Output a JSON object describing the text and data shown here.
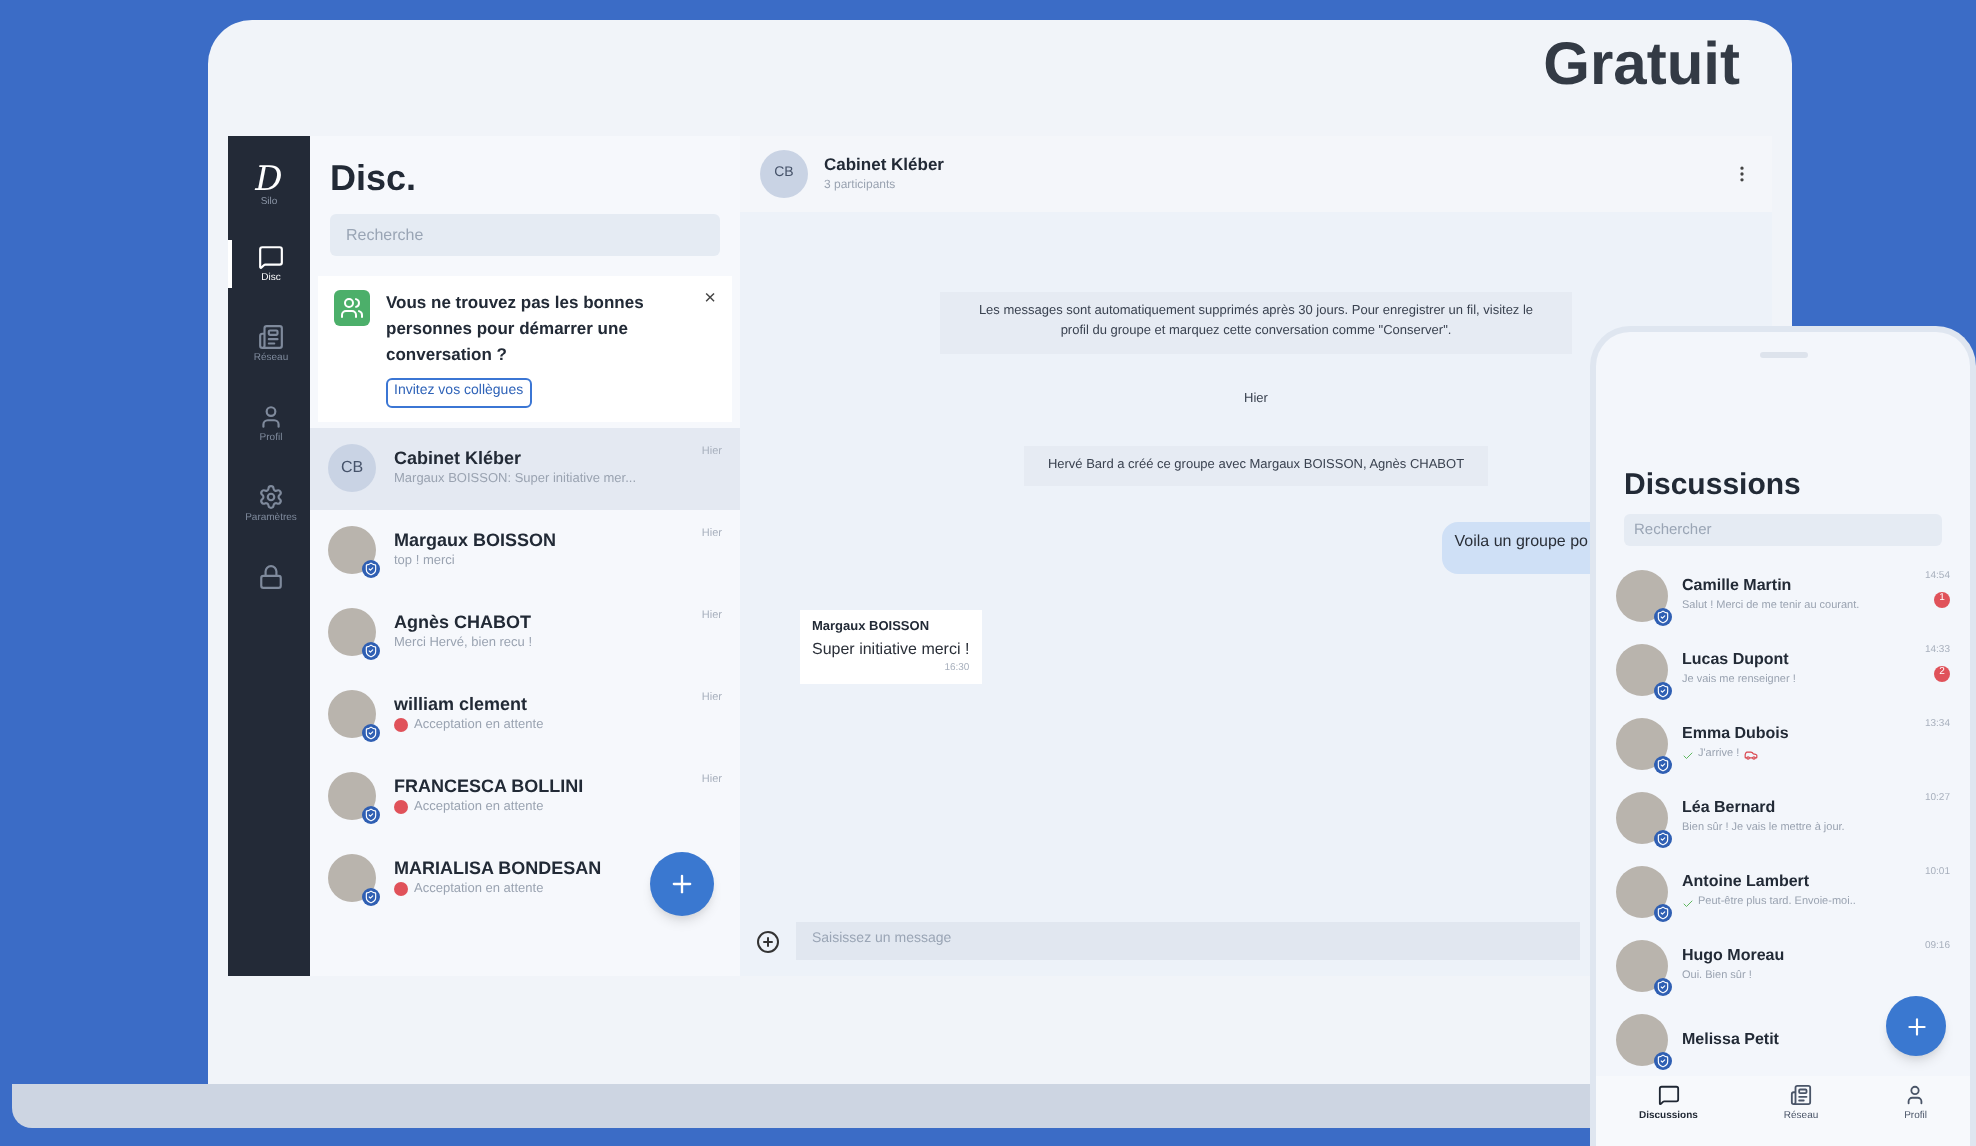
{
  "headline": "Gratuit",
  "laptop": {
    "sidebar": {
      "logo": "D",
      "logo_label": "Silo",
      "items": [
        {
          "label": "Disc",
          "selected": true
        },
        {
          "label": "Réseau",
          "selected": false
        },
        {
          "label": "Profil",
          "selected": false
        },
        {
          "label": "Paramètres",
          "selected": false
        },
        {
          "selected": false
        }
      ]
    },
    "list": {
      "title": "Disc.",
      "search": {
        "placeholder": "Recherche"
      },
      "invite_card": {
        "text": "Vous ne trouvez pas les bonnes personnes pour démarrer une conversation ?",
        "close": "×",
        "button": "Invitez vos collègues"
      },
      "conversations": [
        {
          "kind": "initials",
          "initials": "CB",
          "name": "Cabinet Kléber",
          "preview": "Margaux BOISSON: Super initiative mer...",
          "time": "Hier",
          "selected": true,
          "pending": false
        },
        {
          "kind": "photo",
          "name": "Margaux BOISSON",
          "preview": "top ! merci",
          "time": "Hier",
          "selected": false,
          "pending": false
        },
        {
          "kind": "photo",
          "name": "Agnès CHABOT",
          "preview": "Merci Hervé, bien recu !",
          "time": "Hier",
          "selected": false,
          "pending": false
        },
        {
          "kind": "photo",
          "name": "william clement",
          "preview": "Acceptation en attente",
          "time": "Hier",
          "selected": false,
          "pending": true
        },
        {
          "kind": "photo",
          "name": "FRANCESCA BOLLINI",
          "preview": "Acceptation en attente",
          "time": "Hier",
          "selected": false,
          "pending": true
        },
        {
          "kind": "photo",
          "name": "MARIALISA BONDESAN",
          "preview": "Acceptation en attente",
          "selected": false,
          "pending": true
        }
      ]
    },
    "chat": {
      "header": {
        "initials": "CB",
        "title": "Cabinet Kléber",
        "subtitle": "3 participants"
      },
      "messages": [
        {
          "kind": "system",
          "text": "Les messages sont automatiquement supprimés après 30 jours. Pour enregistrer un fil, visitez le profil du groupe et marquez cette conversation comme \"Conserver\"."
        },
        {
          "kind": "date",
          "text": "Hier"
        },
        {
          "kind": "system",
          "text": "Hervé Bard a créé ce groupe avec Margaux BOISSON, Agnès CHABOT"
        },
        {
          "kind": "outgoing",
          "text": "Voila un groupe po"
        },
        {
          "kind": "incoming",
          "sender": "Margaux BOISSON",
          "text": "Super initiative merci !",
          "time": "16:30"
        }
      ],
      "composer": {
        "placeholder": "Saisissez un message"
      }
    }
  },
  "phone": {
    "title": "Discussions",
    "search": {
      "placeholder": "Rechercher"
    },
    "conversations": [
      {
        "name": "Camille Martin",
        "preview": "Salut ! Merci de me tenir au courant.",
        "time": "14:54",
        "unread": "1",
        "read": false,
        "sticker": false
      },
      {
        "name": "Lucas Dupont",
        "preview": "Je vais me renseigner !",
        "time": "14:33",
        "unread": "2",
        "read": false,
        "sticker": false
      },
      {
        "name": "Emma Dubois",
        "preview": "J'arrive !",
        "time": "13:34",
        "read": true,
        "sticker": true
      },
      {
        "name": "Léa Bernard",
        "preview": "Bien sûr ! Je vais le mettre à jour.",
        "time": "10:27",
        "read": false,
        "sticker": false
      },
      {
        "name": "Antoine Lambert",
        "preview": "Peut-être plus tard. Envoie-moi..",
        "time": "10:01",
        "read": true,
        "sticker": false
      },
      {
        "name": "Hugo Moreau",
        "preview": "Oui. Bien sûr !",
        "time": "09:16",
        "read": false,
        "sticker": false
      },
      {
        "name": "Melissa Petit",
        "read": false,
        "sticker": false
      }
    ],
    "nav": [
      {
        "label": "Discussions",
        "selected": true
      },
      {
        "label": "Réseau",
        "selected": false
      },
      {
        "label": "Profil",
        "selected": false
      }
    ]
  }
}
